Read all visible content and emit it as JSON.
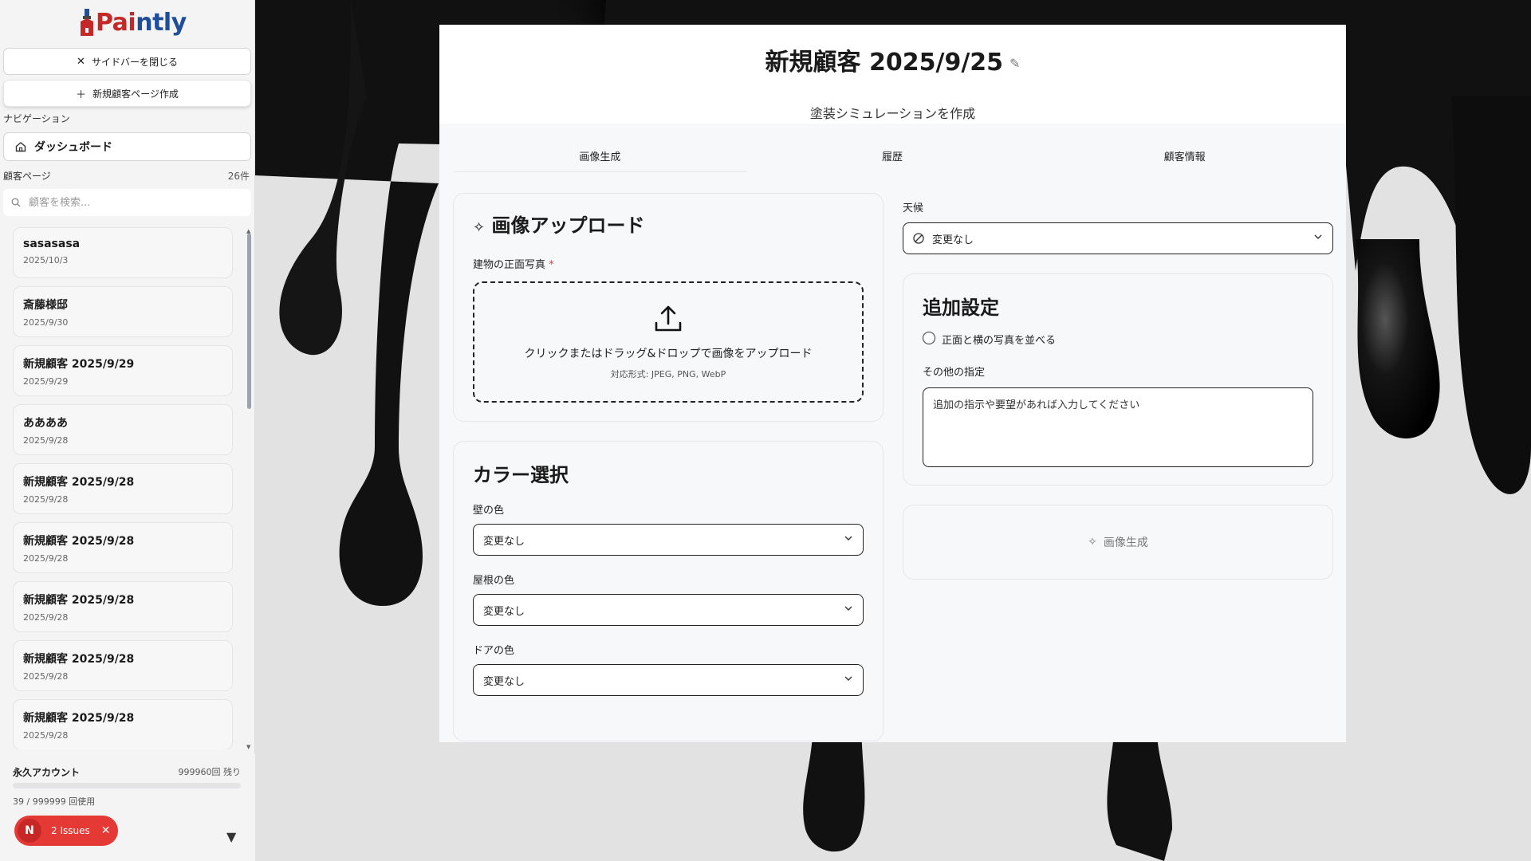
{
  "app": {
    "logo_part1": "Pai",
    "logo_part2": "ntly"
  },
  "sidebar": {
    "close_label": "サイドバーを閉じる",
    "new_page_label": "新規顧客ページ作成",
    "nav_section": "ナビゲーション",
    "dashboard_label": "ダッシュボード",
    "customers_section": "顧客ページ",
    "customers_count": "26件",
    "search_placeholder": "顧客を検索...",
    "customers": [
      {
        "name": "sasasasa",
        "date": "2025/10/3"
      },
      {
        "name": "斎藤様邸",
        "date": "2025/9/30"
      },
      {
        "name": "新規顧客 2025/9/29",
        "date": "2025/9/29"
      },
      {
        "name": "ああああ",
        "date": "2025/9/28"
      },
      {
        "name": "新規顧客 2025/9/28",
        "date": "2025/9/28"
      },
      {
        "name": "新規顧客 2025/9/28",
        "date": "2025/9/28"
      },
      {
        "name": "新規顧客 2025/9/28",
        "date": "2025/9/28"
      },
      {
        "name": "新規顧客 2025/9/28",
        "date": "2025/9/28"
      },
      {
        "name": "新規顧客 2025/9/28",
        "date": "2025/9/28"
      }
    ],
    "account": {
      "name": "永久アカウント",
      "remaining": "999960回 残り",
      "used_text": "39 / 999999 回使用",
      "usage_fraction": 4e-05
    },
    "issues": {
      "badge": "N",
      "label": "2 Issues"
    }
  },
  "main": {
    "title": "新規顧客 2025/9/25",
    "subtitle": "塗装シミュレーションを作成",
    "tabs": [
      "画像生成",
      "履歴",
      "顧客情報"
    ],
    "upload": {
      "title": "画像アップロード",
      "field_label": "建物の正面写真",
      "required_mark": "*",
      "drop_text": "クリックまたはドラッグ&ドロップで画像をアップロード",
      "formats": "対応形式: JPEG, PNG, WebP"
    },
    "colors": {
      "title": "カラー選択",
      "wall_label": "壁の色",
      "wall_value": "変更なし",
      "roof_label": "屋根の色",
      "roof_value": "変更なし",
      "door_label": "ドアの色",
      "door_value": "変更なし"
    },
    "weather": {
      "label": "天候",
      "value": "変更なし"
    },
    "extra": {
      "title": "追加設定",
      "checkbox_label": "正面と横の写真を並べる",
      "other_label": "その他の指定",
      "other_placeholder": "追加の指示や要望があれば入力してください"
    },
    "generate_label": "画像生成"
  },
  "colors": {
    "accent_red": "#e53935",
    "logo_blue": "#1f4f9a",
    "logo_red": "#c62828"
  }
}
